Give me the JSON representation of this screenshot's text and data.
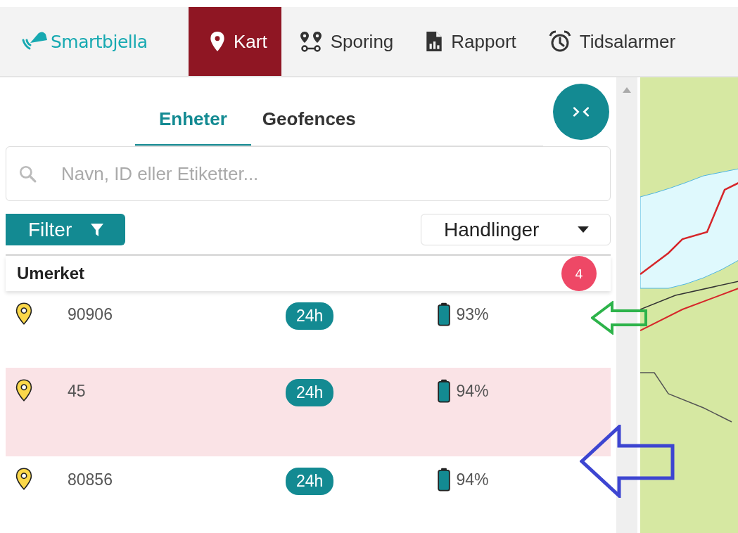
{
  "nav": {
    "logo": "Smartbjella",
    "items": [
      {
        "label": "Kart",
        "kind": "pin",
        "selected": true
      },
      {
        "label": "Sporing",
        "kind": "track",
        "selected": false
      },
      {
        "label": "Rapport",
        "kind": "report",
        "selected": false
      },
      {
        "label": "Tidsalarmer",
        "kind": "alarm",
        "selected": false
      }
    ]
  },
  "tabs": [
    {
      "label": "Enheter",
      "selected": true
    },
    {
      "label": "Geofences",
      "selected": false
    }
  ],
  "search": {
    "placeholder": "Navn, ID eller Etiketter..."
  },
  "filter_button": "Filter",
  "actions_dropdown": "Handlinger",
  "group": {
    "title": "Umerket",
    "count": "4"
  },
  "rows": [
    {
      "id": "90906",
      "period": "24h",
      "battery": "93%",
      "selected": false
    },
    {
      "id": "45",
      "period": "24h",
      "battery": "94%",
      "selected": true
    },
    {
      "id": "80856",
      "period": "24h",
      "battery": "94%",
      "selected": false
    }
  ],
  "annotations": [
    {
      "kind": "green"
    },
    {
      "kind": "blue"
    }
  ]
}
